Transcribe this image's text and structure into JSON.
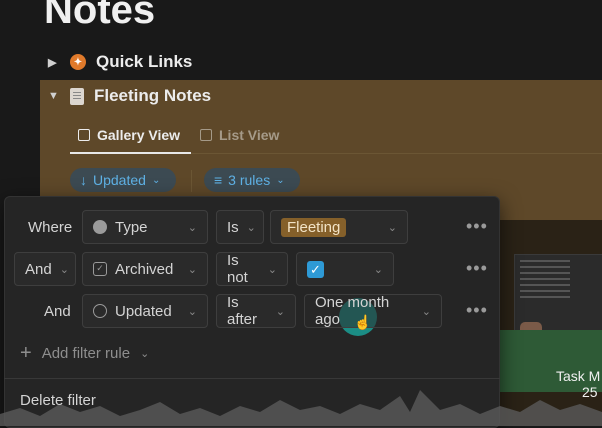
{
  "page": {
    "title": "Notes"
  },
  "sections": {
    "quick_links": {
      "label": "Quick Links"
    },
    "fleeting_notes": {
      "label": "Fleeting Notes"
    }
  },
  "views": {
    "gallery": {
      "label": "Gallery View",
      "icon": "grid-icon"
    },
    "list": {
      "label": "List View",
      "icon": "list-icon"
    }
  },
  "toolbar": {
    "sort_pill": "Updated",
    "rules_pill": "3 rules"
  },
  "filter": {
    "rows": [
      {
        "conjunction": "Where",
        "property": "Type",
        "property_icon": "circle-chevron-icon",
        "operator": "Is",
        "value": "Fleeting"
      },
      {
        "conjunction": "And",
        "property": "Archived",
        "property_icon": "checkbox-icon",
        "operator": "Is not",
        "value_checked": true
      },
      {
        "conjunction": "And",
        "property": "Updated",
        "property_icon": "clock-icon",
        "operator": "Is after",
        "value": "One month ago"
      }
    ],
    "add_rule_label": "Add filter rule",
    "delete_label": "Delete filter",
    "more_label": "•••"
  },
  "background": {
    "task_label": "Task M",
    "number_label": "25"
  },
  "colors": {
    "accent_blue": "#5fb2e6",
    "tag_fleeting": "#85602a",
    "checkbox_blue": "#2e9ad6",
    "cursor_halo": "#1aa096",
    "section_bg": "#5e4829"
  }
}
